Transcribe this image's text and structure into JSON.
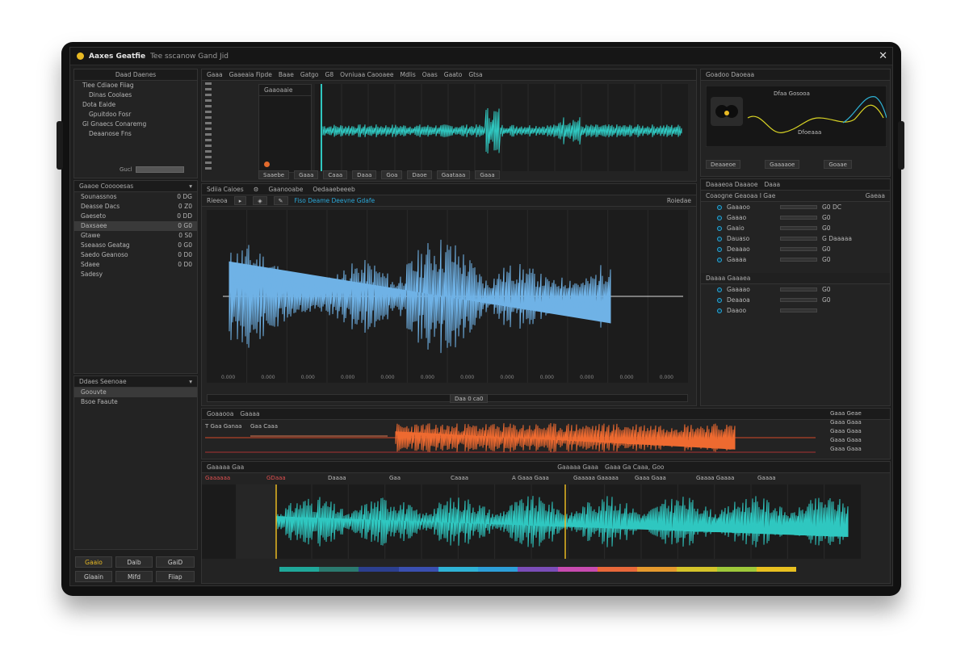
{
  "window": {
    "app_name": "Aaxes Geatfie",
    "app_subtitle": "Tee sscanow Gand Jid",
    "close_glyph": "✕"
  },
  "browser": {
    "title": "Daad Daenes",
    "items": [
      {
        "label": "Tiee Cdiaoe Fiiag"
      },
      {
        "label": "Dinas Coolaes"
      },
      {
        "label": "Dota Eaide"
      },
      {
        "label": "Gpuitdoo Fosr"
      },
      {
        "label": "Gl Gnaecs Conaremg"
      },
      {
        "label": "Deaanose Fns"
      }
    ],
    "footer_label": "Gucl"
  },
  "tracks_panel": {
    "title": "Gaaoe Cooooesas",
    "tracks": [
      {
        "label": "Sounassnos",
        "value": "0 DG"
      },
      {
        "label": "Deasse Dacs",
        "value": "0 Z0"
      },
      {
        "label": "Gaeseto",
        "value": "0 DD"
      },
      {
        "label": "Daxsaee",
        "value": "0 G0"
      },
      {
        "label": "Gtawe",
        "value": "0 S0"
      },
      {
        "label": "Sseaaso Geatag",
        "value": "0 G0"
      },
      {
        "label": "Saedo Geanoso",
        "value": "0 D0"
      },
      {
        "label": "Sdaee",
        "value": "0 D0"
      },
      {
        "label": "Sadesy",
        "value": ""
      }
    ]
  },
  "sub_panel": {
    "title": "Ddaes Seenoae",
    "items": [
      {
        "label": "Goouvte"
      },
      {
        "label": "Bsoe Faaute"
      }
    ]
  },
  "bottom_left_buttons": [
    "Gaaio",
    "Daib",
    "GaiD",
    "Glaain",
    "Mifd",
    "Fiiap"
  ],
  "top_editor": {
    "tabs": [
      "Gaaa",
      "Gaaeaia Fipde",
      "Baae",
      "Gatgo",
      "G8",
      "Ovniuaa Caooaee",
      "Mdlis",
      "Oaas",
      "Gaato",
      "Gtsa"
    ],
    "list_title": "Gaaoaaie",
    "bottom_tabs": [
      "Saaebe",
      "Gaaa",
      "Caaa",
      "Daaa",
      "Goa",
      "Daoe",
      "Gaataaa",
      "Gaaa"
    ]
  },
  "main_editor": {
    "toolbar": [
      "Sdiia Caioes",
      "Gaanooabe",
      "Oedaaebeeeb"
    ],
    "subtoolbar_label": "Rieeoa",
    "overlay_text": "Fiso Deame Deevne Gdafe",
    "right_label": "Roiedae",
    "time_ticks": [
      "0.000",
      "0.000",
      "0.000",
      "0.000",
      "0.000",
      "0.000",
      "0.000",
      "0.000",
      "0.000",
      "0.000",
      "0.000",
      "0.000"
    ],
    "footer_field": "Daa 0 ca0"
  },
  "eq_panel": {
    "title": "Goadoo Daoeaa",
    "curve_label": "Dfaa Gosooa",
    "band_label": "Dfoeaaa",
    "buttons": [
      "Deaaeoe",
      "Gaaaaoe",
      "Goaae"
    ]
  },
  "effects_panel": {
    "tabs": [
      "Daaaeoa Daaaoe",
      "Daaa"
    ],
    "section1_title": "Coaogne Geaoaa I Gae",
    "section1_right": "Gaeaa",
    "rows1": [
      {
        "label": "Gaaaoo",
        "value": "G0 DC"
      },
      {
        "label": "Gaaao",
        "value": "G0"
      },
      {
        "label": "Gaaio",
        "value": "G0"
      },
      {
        "label": "Dauaso",
        "value": "G Daaaaa"
      },
      {
        "label": "Deaaao",
        "value": "G0"
      },
      {
        "label": "Gaaaa",
        "value": "G0"
      }
    ],
    "section2_title": "Daaaa Gaaaea",
    "rows2": [
      {
        "label": "Gaaaao",
        "value": "G0"
      },
      {
        "label": "Deaaoa",
        "value": "G0"
      },
      {
        "label": "Daaoo",
        "value": ""
      }
    ]
  },
  "spectral": {
    "header": [
      "Goaaooa",
      "Gaaaa"
    ],
    "track_labels": [
      "T Gaa Ganaa",
      "Gaa Caaa"
    ],
    "right_labels": [
      "Gaaa Geae",
      "Gaaa Gaaa",
      "Gaaa Gaaa",
      "Gaaa Gaaa",
      "Gaaa Gaaa"
    ]
  },
  "timeline": {
    "header": [
      "Gaaaaa Gaa",
      "Gaaaaa Gaaa",
      "Gaaa Ga Caaa, Goo"
    ],
    "markers": [
      "Gaaaaaa",
      "GDaaa",
      "Daaaa",
      "Gaa",
      "Caaaa",
      "A Gaaa Gaaa",
      "Gaaaaa Gaaaaa",
      "Gaaa Gaaa",
      "Gaaaa Gaaaa",
      "Gaaaa"
    ],
    "colors": [
      "#1fa89a",
      "#2b7a6f",
      "#2c3f8f",
      "#3a4fb0",
      "#2fb3d6",
      "#2d9fd9",
      "#7b4db8",
      "#c84bb0",
      "#e8683a",
      "#e69a2e",
      "#d4c42a",
      "#9ec93a",
      "#e8c020"
    ]
  }
}
